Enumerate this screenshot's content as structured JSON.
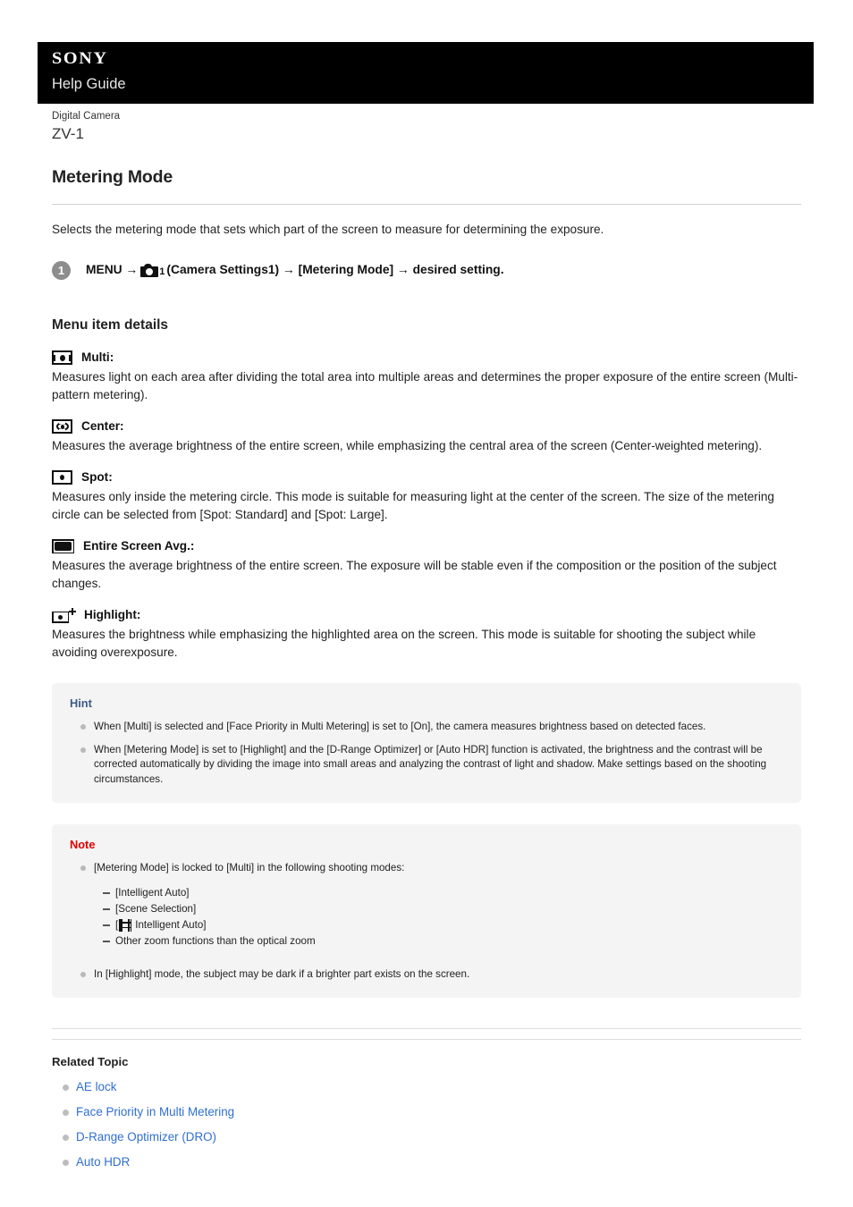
{
  "header": {
    "brand": "SONY",
    "subtitle": "Help Guide"
  },
  "product": {
    "category": "Digital Camera",
    "model": "ZV-1"
  },
  "page": {
    "title": "Metering Mode",
    "lead": "Selects the metering mode that sets which part of the screen to measure for determining the exposure."
  },
  "step": {
    "number": "1",
    "part1": "MENU →",
    "camera_icon": "camera-settings1-icon",
    "camera_sub": "1",
    "part2": "(Camera Settings1) → [Metering Mode] → desired setting."
  },
  "menu_details": {
    "heading": "Menu item details",
    "items": [
      {
        "icon": "metering-multi-icon",
        "label": "Multi:",
        "body": "Measures light on each area after dividing the total area into multiple areas and determines the proper exposure of the entire screen (Multi-pattern metering)."
      },
      {
        "icon": "metering-center-icon",
        "label": "Center:",
        "body": "Measures the average brightness of the entire screen, while emphasizing the central area of the screen (Center-weighted metering)."
      },
      {
        "icon": "metering-spot-icon",
        "label": "Spot:",
        "body": "Measures only inside the metering circle. This mode is suitable for measuring light at the center of the screen. The size of the metering circle can be selected from [Spot: Standard] and [Spot: Large]."
      },
      {
        "icon": "metering-entire-screen-avg-icon",
        "label": "Entire Screen Avg.:",
        "body": "Measures the average brightness of the entire screen. The exposure will be stable even if the composition or the position of the subject changes."
      },
      {
        "icon": "metering-highlight-icon",
        "label": "Highlight:",
        "body": "Measures the brightness while emphasizing the highlighted area on the screen. This mode is suitable for shooting the subject while avoiding overexposure."
      }
    ]
  },
  "hint": {
    "title": "Hint",
    "color": "#3d5a8a",
    "bullets": [
      "When [Multi] is selected and [Face Priority in Multi Metering] is set to [On], the camera measures brightness based on detected faces.",
      "When [Metering Mode] is set to [Highlight] and the [D-Range Optimizer] or [Auto HDR] function is activated, the brightness and the contrast will be corrected automatically by dividing the image into small areas and analyzing the contrast of light and shadow. Make settings based on the shooting circumstances."
    ]
  },
  "note": {
    "title": "Note",
    "color": "#e00000",
    "bullet1": "[Metering Mode] is locked to [Multi] in the following shooting modes:",
    "sub_items": [
      {
        "text": "[Intelligent Auto]",
        "icon": null
      },
      {
        "text": "[Scene Selection]",
        "icon": null
      },
      {
        "prefix": "[",
        "icon": "movie-mode-icon",
        "text": "Intelligent Auto]"
      },
      {
        "text": "Other zoom functions than the optical zoom",
        "icon": null
      }
    ],
    "bullet2": "In [Highlight] mode, the subject may be dark if a brighter part exists on the screen."
  },
  "related": {
    "title": "Related Topic",
    "links": [
      "AE lock",
      "Face Priority in Multi Metering",
      "D-Range Optimizer (DRO)",
      "Auto HDR"
    ],
    "link_color": "#2f6fd0"
  }
}
